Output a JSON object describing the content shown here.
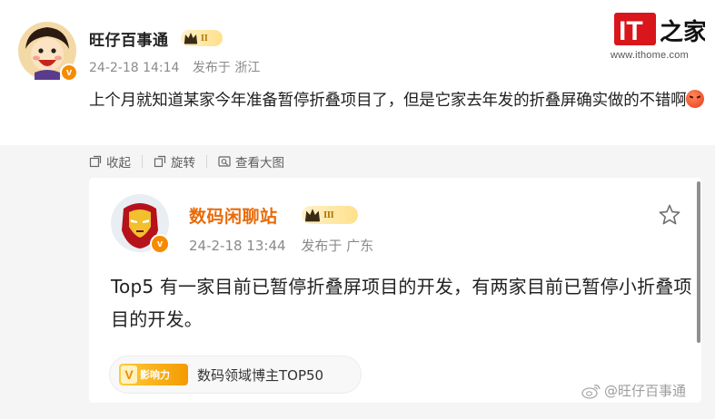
{
  "post": {
    "username": "旺仔百事通",
    "level": "II",
    "vbadge": "v",
    "timestamp": "24-2-18 14:14",
    "location": "发布于 浙江",
    "content": "上个月就知道某家今年准备暂停折叠项目了，但是它家去年发的折叠屏确实做的不错啊",
    "actions": {
      "collapse_label": "收起",
      "rotate_label": "旋转",
      "view_large_label": "查看大图"
    }
  },
  "logo": {
    "text_it": "IT",
    "text_home": "之家",
    "url": "www.ithome.com"
  },
  "quoted": {
    "username": "数码闲聊站",
    "level": "III",
    "vbadge": "v",
    "timestamp": "24-2-18 13:44",
    "location": "发布于 广东",
    "content": "Top5 有一家目前已暂停折叠屏项目的开发，有两家目前已暂停小折叠项目的开发。",
    "tag_badge": "影响力",
    "tag_badge_v": "V",
    "tag_text": "数码领域博主TOP50"
  },
  "watermark": "@旺仔百事通",
  "colors": {
    "brand_orange": "#e86b0a",
    "vbadge": "#f78b00",
    "logo_red": "#d8161c"
  }
}
